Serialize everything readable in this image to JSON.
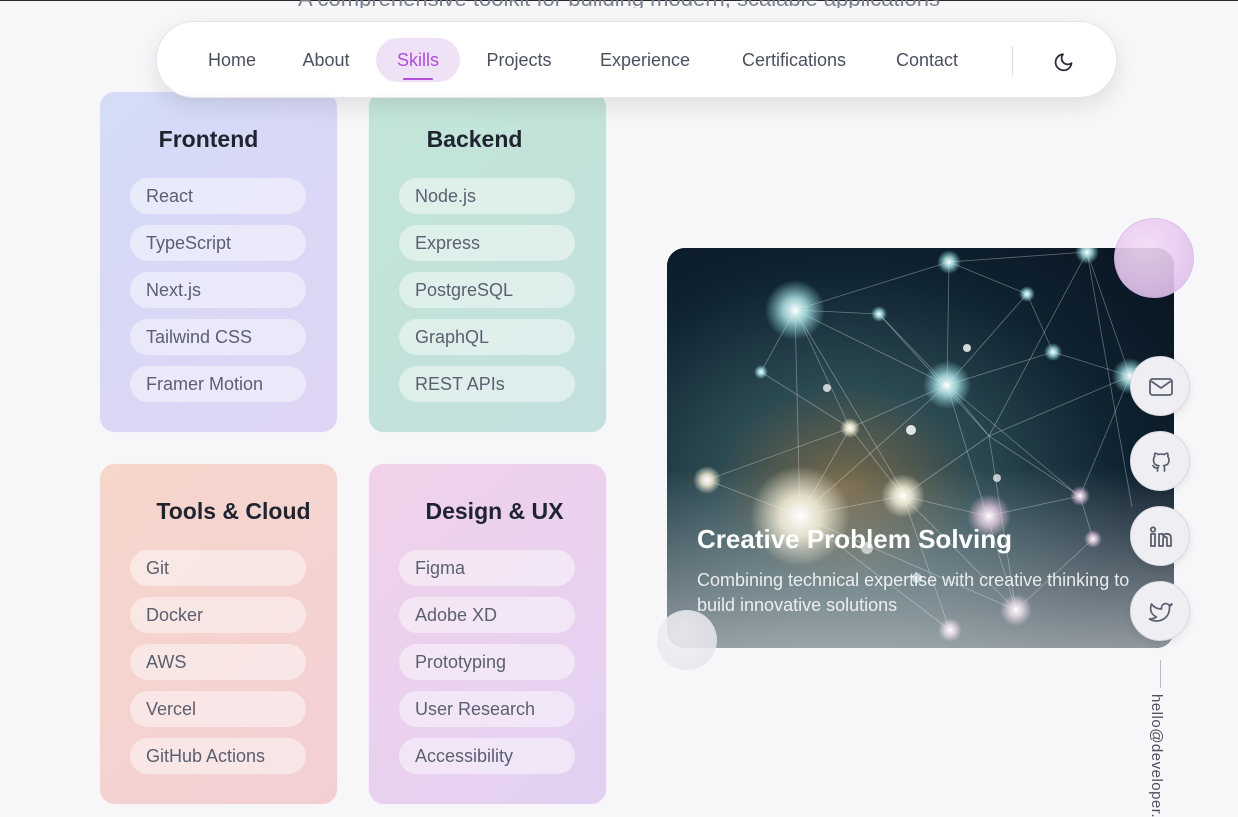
{
  "header": {
    "tagline": "A comprehensive toolkit for building modern, scalable applications"
  },
  "nav": {
    "items": [
      {
        "label": "Home",
        "active": false
      },
      {
        "label": "About",
        "active": false
      },
      {
        "label": "Skills",
        "active": true
      },
      {
        "label": "Projects",
        "active": false
      },
      {
        "label": "Experience",
        "active": false
      },
      {
        "label": "Certifications",
        "active": false
      },
      {
        "label": "Contact",
        "active": false
      }
    ],
    "theme_icon": "moon-icon",
    "accent_color": "#b04ed8"
  },
  "skills": [
    {
      "title": "Frontend",
      "items": [
        "React",
        "TypeScript",
        "Next.js",
        "Tailwind CSS",
        "Framer Motion"
      ]
    },
    {
      "title": "Backend",
      "items": [
        "Node.js",
        "Express",
        "PostgreSQL",
        "GraphQL",
        "REST APIs"
      ]
    },
    {
      "title": "Tools & Cloud",
      "items": [
        "Git",
        "Docker",
        "AWS",
        "Vercel",
        "GitHub Actions"
      ]
    },
    {
      "title": "Design & UX",
      "items": [
        "Figma",
        "Adobe XD",
        "Prototyping",
        "User Research",
        "Accessibility"
      ]
    }
  ],
  "feature": {
    "title": "Creative Problem Solving",
    "description": "Combining technical expertise with creative thinking to build innovative solutions"
  },
  "social": {
    "icons": [
      "mail-icon",
      "github-icon",
      "linkedin-icon",
      "twitter-icon"
    ],
    "email": "hello@developer."
  }
}
